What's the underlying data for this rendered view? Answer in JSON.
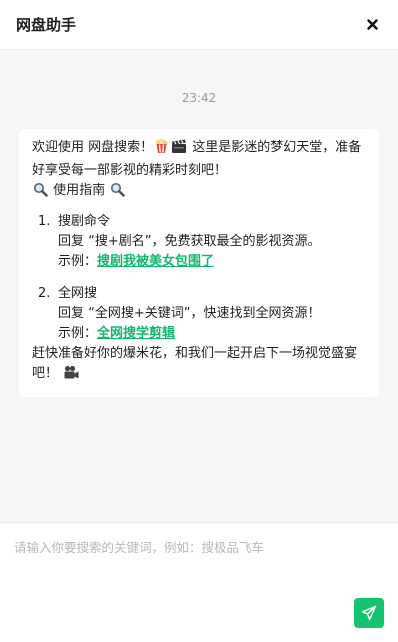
{
  "header": {
    "title": "网盘助手",
    "close_label": "×"
  },
  "chat": {
    "timestamp": "23:42",
    "message": {
      "intro": "欢迎使用 网盘搜索！",
      "intro_tail": "这里是影迷的梦幻天堂，准备好享受每一部影视的精彩时刻吧！",
      "guide_title": "使用指南",
      "items": [
        {
          "number": "1.",
          "title": "搜剧命令",
          "description": "回复 “搜+剧名”，免费获取最全的影视资源。",
          "example_label": "示例：",
          "example_link": "搜剧我被美女包围了"
        },
        {
          "number": "2.",
          "title": "全网搜",
          "description": "回复 “全网搜+关键词”，快速找到全网资源！",
          "example_label": "示例：",
          "example_link": "全网搜学剪辑"
        }
      ],
      "outro": "赶快准备好你的爆米花，和我们一起开启下一场视觉盛宴吧！"
    }
  },
  "input": {
    "placeholder": "请输入你要搜索的关键词，例如：搜极品飞车",
    "value": ""
  },
  "icons": {
    "close": "close-icon",
    "popcorn": "popcorn-icon",
    "clapper": "clapper-board-icon",
    "magnifier": "magnifying-glass-icon",
    "camera": "movie-camera-icon",
    "send": "send-icon"
  },
  "colors": {
    "accent": "#14c46e",
    "link": "#12b86d"
  }
}
